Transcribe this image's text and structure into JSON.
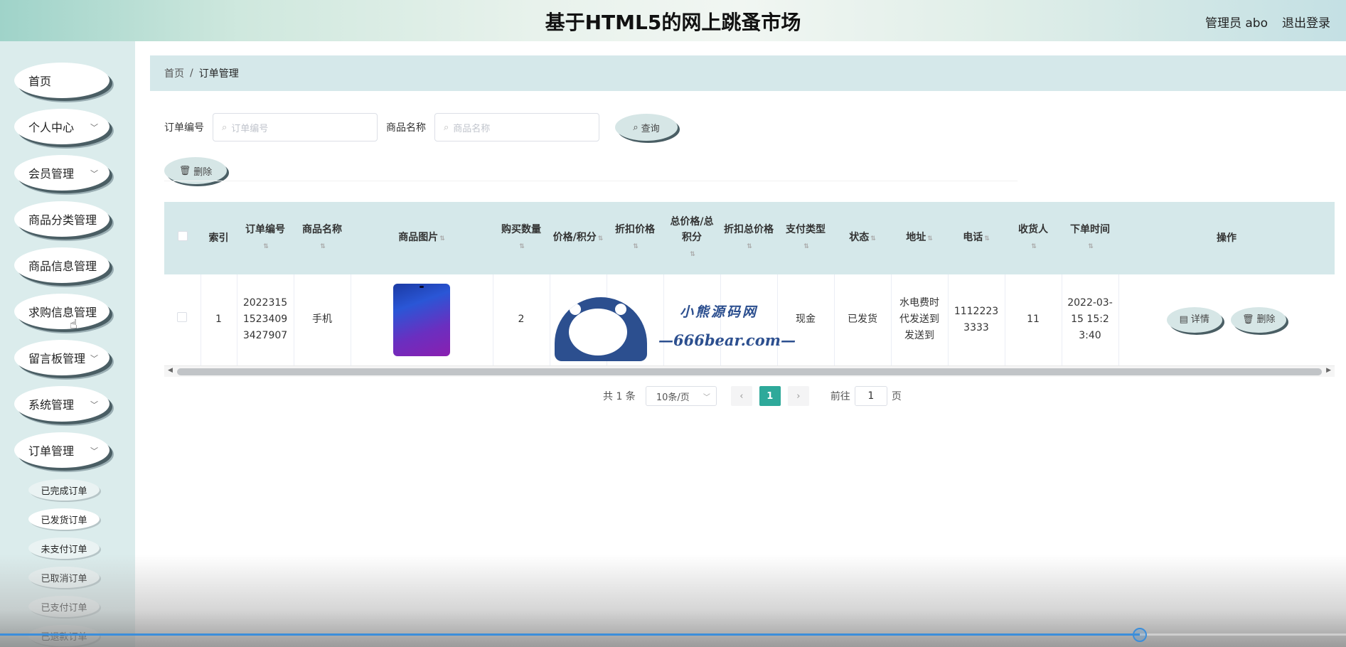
{
  "header": {
    "title": "基于HTML5的网上跳蚤市场",
    "admin_label": "管理员 abo",
    "logout_label": "退出登录"
  },
  "sidebar": {
    "items": [
      {
        "label": "首页",
        "has_children": false
      },
      {
        "label": "个人中心",
        "has_children": true
      },
      {
        "label": "会员管理",
        "has_children": true
      },
      {
        "label": "商品分类管理",
        "has_children": true
      },
      {
        "label": "商品信息管理",
        "has_children": true
      },
      {
        "label": "求购信息管理",
        "has_children": true
      },
      {
        "label": "留言板管理",
        "has_children": true
      },
      {
        "label": "系统管理",
        "has_children": true
      },
      {
        "label": "订单管理",
        "has_children": true,
        "expanded": true
      }
    ],
    "order_sub_items": [
      {
        "label": "已完成订单"
      },
      {
        "label": "已发货订单",
        "active": true
      },
      {
        "label": "未支付订单"
      },
      {
        "label": "已取消订单"
      },
      {
        "label": "已支付订单"
      },
      {
        "label": "已退款订单"
      }
    ]
  },
  "breadcrumb": {
    "home": "首页",
    "separator": "/",
    "current": "订单管理"
  },
  "search": {
    "order_no_label": "订单编号",
    "order_no_placeholder": "订单编号",
    "product_name_label": "商品名称",
    "product_name_placeholder": "商品名称",
    "query_button": "查询"
  },
  "toolbar": {
    "delete_button": "删除"
  },
  "table": {
    "columns": [
      "索引",
      "订单编号",
      "商品名称",
      "商品图片",
      "购买数量",
      "价格/积分",
      "折扣价格",
      "总价格/总积分",
      "折扣总价格",
      "支付类型",
      "状态",
      "地址",
      "电话",
      "收货人",
      "下单时间",
      "操作"
    ],
    "rows": [
      {
        "index": "1",
        "order_no": "20223151523409 3427907",
        "product_name": "手机",
        "quantity": "2",
        "price": "",
        "discount_price": "",
        "total_price": "",
        "discount_total": "",
        "payment_type": "现金",
        "status": "已发货",
        "address": "水电费时代发送到发送到",
        "phone": "11122233333",
        "receiver": "11",
        "order_time": "2022-03-15 15:23:40",
        "detail_button": "详情",
        "delete_button": "删除"
      }
    ]
  },
  "watermark": {
    "title": "小熊源码网",
    "url": "—666bear.com—"
  },
  "pagination": {
    "total_text": "共 1 条",
    "page_size": "10条/页",
    "current_page": "1",
    "goto_prefix": "前往",
    "goto_value": "1",
    "goto_suffix": "页"
  },
  "video": {
    "progress": 0.847
  }
}
